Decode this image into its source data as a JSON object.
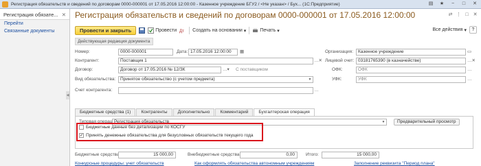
{
  "window": {
    "title": "Регистрация обязательств и сведений по договорам 0000-000001 от 17.05.2016 12:00:00 - Казенное учреждение БГУ2 / <Не указан> / Бух... (1С:Предприятие)",
    "buttons": [
      "▤",
      "★",
      "−",
      "□",
      "✕"
    ]
  },
  "sidebar": {
    "title": "Регистрация обязате...",
    "close": "✕",
    "links": [
      "Перейти",
      "Связанные документы"
    ],
    "collapse": "◀"
  },
  "doc": {
    "title": "Регистрация обязательств и сведений по договорам 0000-000001 от 17.05.2016 12:00:00",
    "title_icons": [
      "⇄",
      "⋮",
      "□",
      "✕"
    ]
  },
  "toolbar": {
    "post_close": "Провести и закрыть",
    "post": "Провести",
    "create_based": "Создать на основании",
    "print": "Печать",
    "all_actions": "Все действия",
    "help": "?"
  },
  "banner": "Действующая редакция документа",
  "fields": {
    "number_label": "Номер:",
    "number": "0000-000001",
    "date_label": "Дата:",
    "date": "17.05.2016 12:00:00",
    "org_label": "Организация:",
    "org": "Казенное учреждение",
    "contractor_label": "Контрагент:",
    "contractor": "Поставщик 1",
    "account_label": "Лицевой счет:",
    "account": "03181765390 (в казначействе)",
    "contract_label": "Договор:",
    "contract": "Договор от 17.05.2016 № 12/ЗК",
    "with_supplier": "С поставщиком",
    "ofk_label": "ОФК:",
    "ofk": "ОФК",
    "obligation_label": "Вид обязательства:",
    "obligation": "Принятое обязательство (с учетом предмета)",
    "ufk_label": "УФК:",
    "ufk": "УФК",
    "counterparty_account_label": "Счет контрагента:"
  },
  "tabs": [
    {
      "label": "Бюджетные средства (1)",
      "active": false
    },
    {
      "label": "Контрагенты",
      "active": false
    },
    {
      "label": "Дополнительно",
      "active": false
    },
    {
      "label": "Комментарий",
      "active": false
    },
    {
      "label": "Бухгалтерская операция",
      "active": true
    }
  ],
  "operation": {
    "label": "Типовая операция:",
    "value": "Регистрация обязательств",
    "preview": "Предварительный просмотр"
  },
  "checkboxes": [
    {
      "label": "Бюджетные данные без детализации по КОСГУ",
      "checked": false
    },
    {
      "label": "Принять денежные обязательства для безусловных обязательств текущего года",
      "checked": true
    }
  ],
  "totals": {
    "budget_label": "Бюджетные средства:",
    "budget": "15 000,00",
    "offbudget_label": "Внебюджетные средства:",
    "offbudget": "0,00",
    "total_label": "Итого:",
    "total": "15 000,00"
  },
  "footer": {
    "competitive": "Конкурсные процедуры: учет обязательств",
    "autonomous": "Как оформлять обязательства автономным учреждениям",
    "fill_details": "Заполнение реквизита \"Период плана\""
  }
}
